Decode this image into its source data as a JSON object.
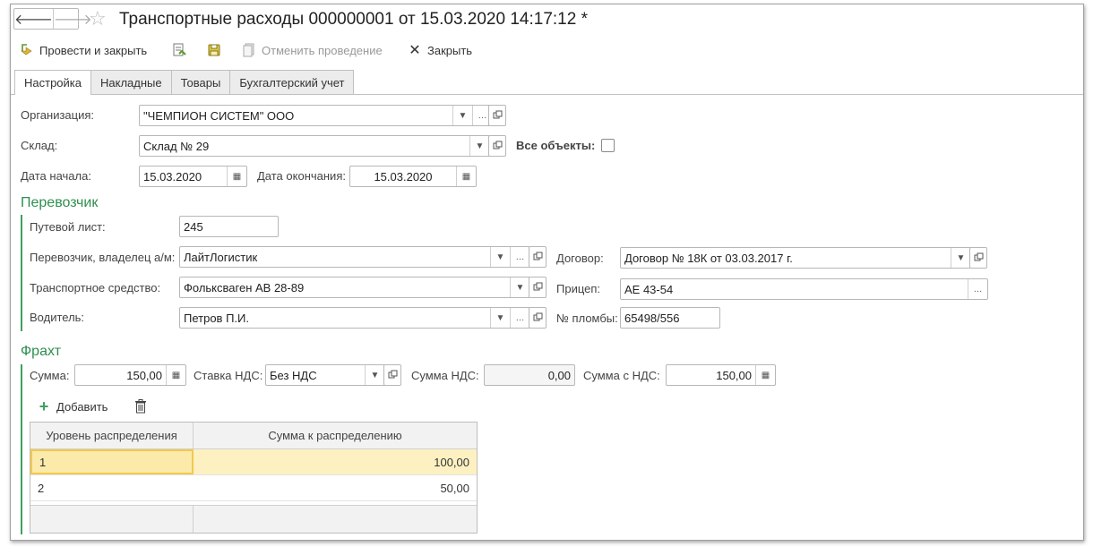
{
  "window": {
    "title": "Транспортные расходы 000000001 от 15.03.2020 14:17:12 *",
    "nav_back": "🡐",
    "nav_forward": "🡒"
  },
  "toolbar": {
    "post_close": "Провести и закрыть",
    "cancel_post": "Отменить проведение",
    "close": "Закрыть"
  },
  "tabs": [
    "Настройка",
    "Накладные",
    "Товары",
    "Бухгалтерский учет"
  ],
  "form": {
    "org_label": "Организация:",
    "org_value": "\"ЧЕМПИОН СИСТЕМ\" ООО",
    "warehouse_label": "Склад:",
    "warehouse_value": "Склад № 29",
    "all_objects_label": "Все объекты:",
    "start_date_label": "Дата начала:",
    "start_date_value": "15.03.2020",
    "end_date_label": "Дата окончания:",
    "end_date_value": "15.03.2020"
  },
  "carrier": {
    "section_title": "Перевозчик",
    "waybill_label": "Путевой лист:",
    "waybill_value": "245",
    "owner_label": "Перевозчик, владелец а/м:",
    "owner_value": "ЛайтЛогистик",
    "vehicle_label": "Транспортное средство:",
    "vehicle_value": "Фольксваген АВ 28-89",
    "driver_label": "Водитель:",
    "driver_value": "Петров П.И.",
    "contract_label": "Договор:",
    "contract_value": "Договор № 18К от 03.03.2017 г.",
    "trailer_label": "Прицеп:",
    "trailer_value": "АЕ 43-54",
    "seal_label": "№ пломбы:",
    "seal_value": "65498/556"
  },
  "freight": {
    "section_title": "Фрахт",
    "sum_label": "Сумма:",
    "sum_value": "150,00",
    "vat_rate_label": "Ставка НДС:",
    "vat_rate_value": "Без НДС",
    "vat_sum_label": "Сумма НДС:",
    "vat_sum_value": "0,00",
    "sum_with_vat_label": "Сумма с НДС:",
    "sum_with_vat_value": "150,00",
    "add_label": "Добавить"
  },
  "table": {
    "columns": [
      "Уровень распределения",
      "Сумма к распределению"
    ],
    "rows": [
      {
        "level": "1",
        "amount": "100,00"
      },
      {
        "level": "2",
        "amount": "50,00"
      }
    ]
  },
  "colors": {
    "accent_green": "#2d8f4e",
    "selection": "#fbeaa9"
  }
}
